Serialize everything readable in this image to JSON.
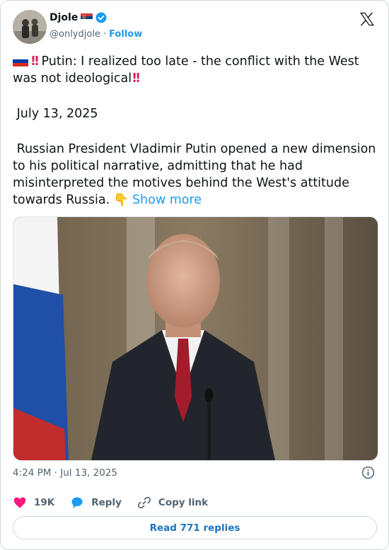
{
  "author": {
    "name": "Djole",
    "handle": "@onlydjole",
    "separator": "·",
    "follow_label": "Follow"
  },
  "post": {
    "line1": "Putin: I realized too late - the conflict with the West was not ideological",
    "date_line": "July 13, 2025",
    "line3": "Russian President Vladimir Putin opened a new dimension to his political narrative, admitting that he had misinterpreted the motives behind the West's attitude towards Russia.",
    "show_more": "Show more",
    "emoji": "👇"
  },
  "meta": {
    "timestamp": "4:24 PM · Jul 13, 2025"
  },
  "actions": {
    "likes": "19K",
    "reply_label": "Reply",
    "copy_label": "Copy link"
  },
  "replies_button": "Read 771 replies",
  "colors": {
    "accent": "#1d9bf0",
    "like": "#f91880",
    "text_secondary": "#536471",
    "border": "#cfd9de"
  },
  "icons": [
    "serbia-flag-icon",
    "verified-badge-icon",
    "x-logo-icon",
    "russia-flag-icon",
    "info-icon",
    "heart-icon",
    "reply-icon",
    "link-icon"
  ]
}
